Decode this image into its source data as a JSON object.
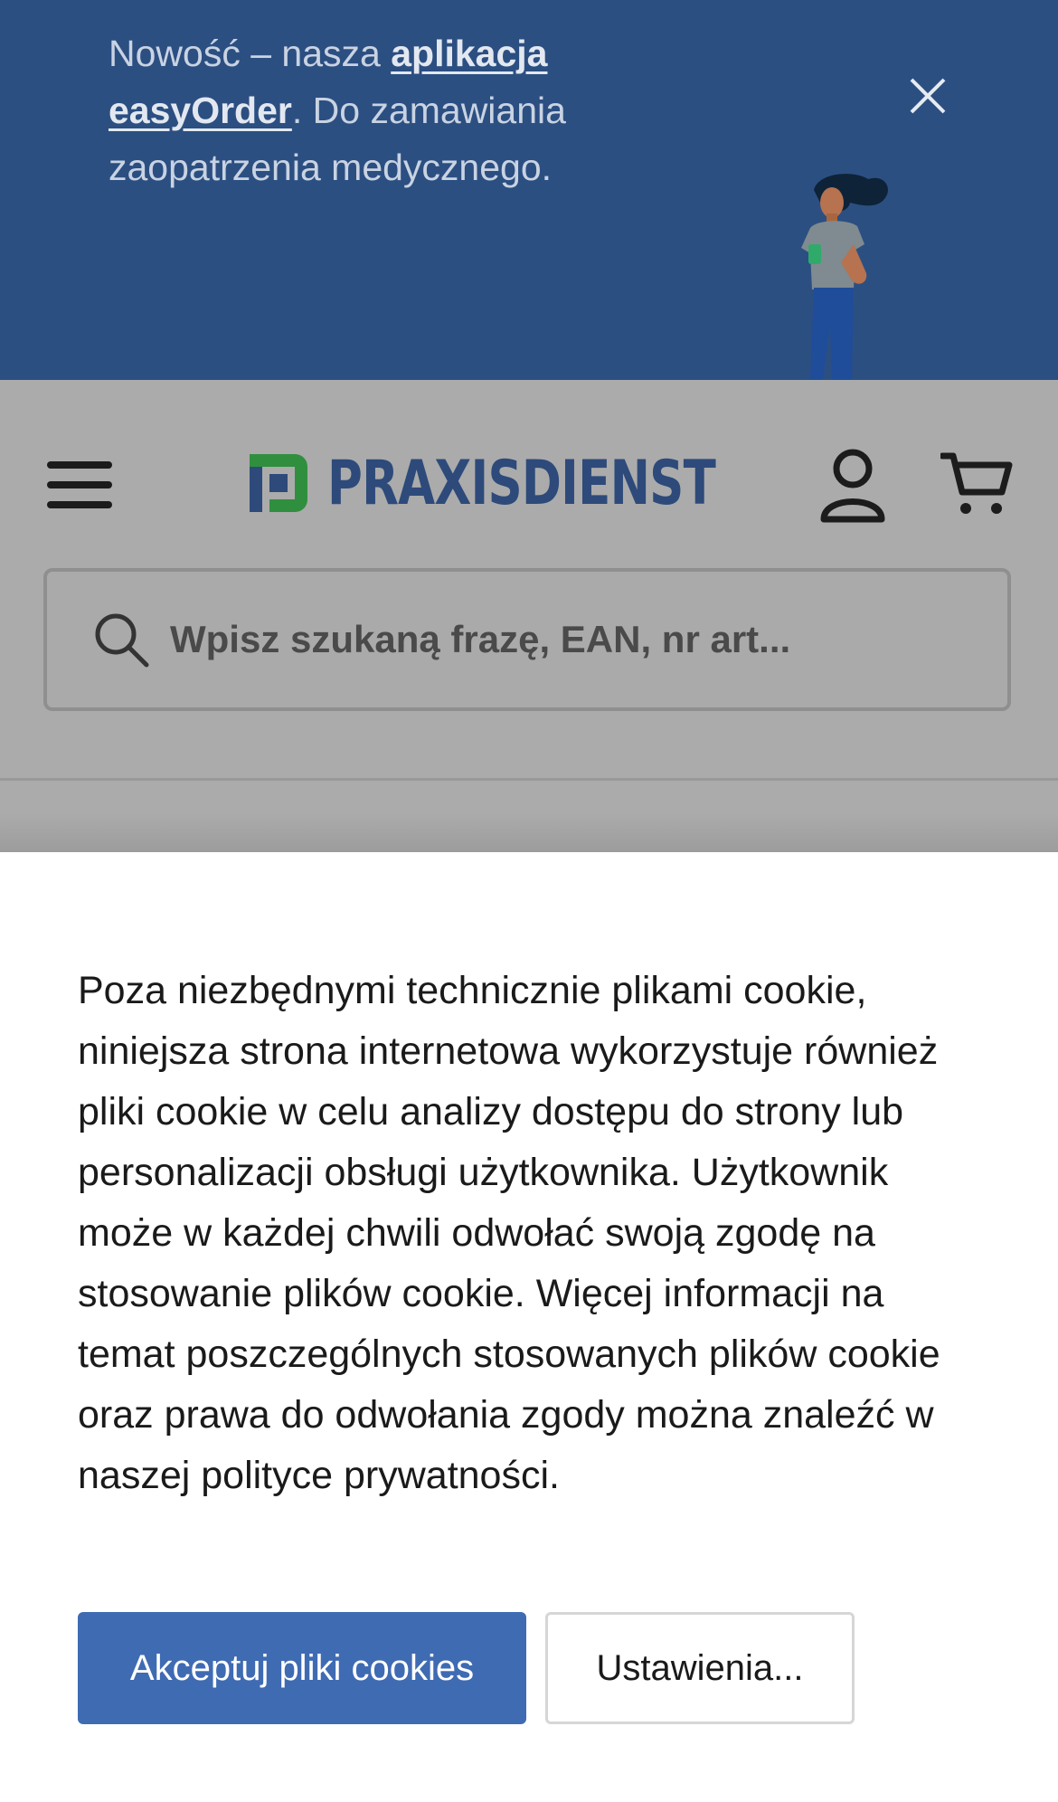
{
  "promo": {
    "text_before": "Nowość – nasza ",
    "link_label": "aplikacja easyOrder",
    "text_after": ". Do zamawiania zaopatrzenia medycznego.",
    "close_icon": "close-icon",
    "background_color": "#2c4f82"
  },
  "header": {
    "menu_icon": "hamburger-menu-icon",
    "logo_text": "PRAXISDIENST",
    "account_icon": "user-account-icon",
    "cart_icon": "shopping-cart-icon",
    "brand_color": "#2d4a7a",
    "logo_accent_color": "#2f8f3e"
  },
  "search": {
    "icon": "search-icon",
    "placeholder": "Wpisz szukaną frazę, EAN, nr art..."
  },
  "cookie_banner": {
    "text": "Poza niezbędnymi technicznie plikami cookie, niniejsza strona internetowa wykorzystuje również pliki cookie w celu analizy dostępu do strony lub personalizacji obsługi użytkownika. Użytkownik może w każdej chwili odwołać swoją zgodę na stosowanie plików cookie. Więcej informacji na temat poszczególnych stosowanych plików cookie oraz prawa do odwołania zgody można znaleźć w naszej polityce prywatności.",
    "accept_label": "Akceptuj pliki cookies",
    "settings_label": "Ustawienia...",
    "accept_color": "#3f6bb3"
  }
}
